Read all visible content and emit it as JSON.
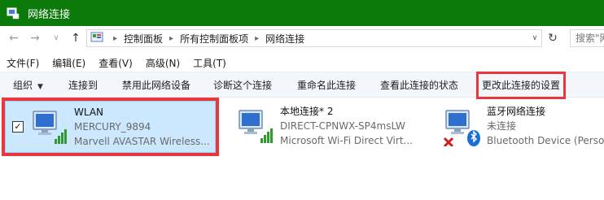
{
  "window": {
    "title": "网络连接",
    "titlebar_color": "#0b7a0b"
  },
  "address": {
    "crumbs": [
      "控制面板",
      "所有控制面板项",
      "网络连接"
    ],
    "search_placeholder": "搜索\"网"
  },
  "menu": {
    "items": [
      "文件(F)",
      "编辑(E)",
      "查看(V)",
      "高级(N)",
      "工具(T)"
    ]
  },
  "commands": {
    "organize": "组织",
    "connect_to": "连接到",
    "disable": "禁用此网络设备",
    "diagnose": "诊断这个连接",
    "rename": "重命名此连接",
    "view_status": "查看此连接的状态",
    "change_settings": "更改此连接的设置"
  },
  "connections": [
    {
      "name": "WLAN",
      "line2": "MERCURY_9894",
      "line3": "Marvell AVASTAR Wireless...",
      "checked": true
    },
    {
      "name": "本地连接* 2",
      "line2": "DIRECT-CPNWX-SP4msLW",
      "line3": "Microsoft Wi-Fi Direct Virt..."
    },
    {
      "name": "蓝牙网络连接",
      "line2": "未连接",
      "line3": "Bluetooth Device (Person"
    }
  ],
  "colors": {
    "highlight": "#e8383d",
    "selection_bg": "#cce8ff",
    "signal_green": "#2f9b2f",
    "bluetooth_blue": "#1a6fd6",
    "error_red": "#d11d1d"
  }
}
